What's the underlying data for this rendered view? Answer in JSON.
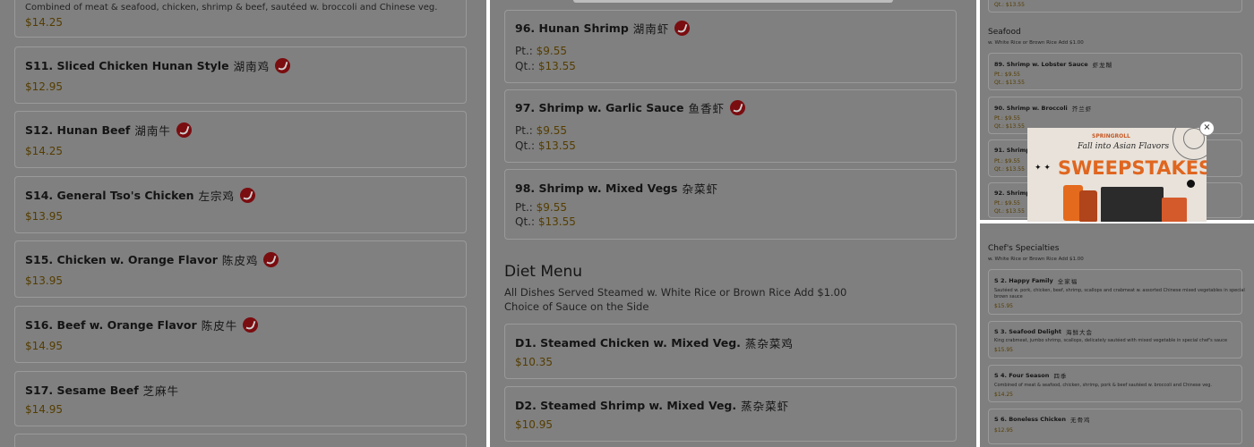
{
  "panel1": {
    "top_desc": "Combined of meat & seafood, chicken, shrimp & beef, sautéed w. broccoli and Chinese veg.",
    "top_price": "$14.25",
    "items": [
      {
        "name": "S11. Sliced Chicken Hunan Style",
        "cn": "湖南鸡",
        "price": "$12.95"
      },
      {
        "name": "S12. Hunan Beef",
        "cn": "湖南牛",
        "price": "$14.25"
      },
      {
        "name": "S14. General Tso's Chicken",
        "cn": "左宗鸡",
        "price": "$13.95"
      },
      {
        "name": "S15. Chicken w. Orange Flavor",
        "cn": "陈皮鸡",
        "price": "$13.95"
      },
      {
        "name": "S16. Beef w. Orange Flavor",
        "cn": "陈皮牛",
        "price": "$14.95"
      },
      {
        "name": "S17. Sesame Beef",
        "cn": "芝麻牛",
        "price": "$14.95"
      }
    ]
  },
  "panel2": {
    "items": [
      {
        "name": "96. Hunan Shrimp",
        "cn": "湖南虾",
        "pt_label": "Pt.:",
        "pt": "$9.55",
        "qt_label": "Qt.:",
        "qt": "$13.55"
      },
      {
        "name": "97. Shrimp w. Garlic Sauce",
        "cn": "鱼香虾",
        "pt_label": "Pt.:",
        "pt": "$9.55",
        "qt_label": "Qt.:",
        "qt": "$13.55"
      },
      {
        "name": "98. Shrimp w. Mixed Vegs",
        "cn": "杂菜虾",
        "pt_label": "Pt.:",
        "pt": "$9.55",
        "qt_label": "Qt.:",
        "qt": "$13.55"
      }
    ],
    "diet": {
      "title": "Diet Menu",
      "line1": "All Dishes Served Steamed w. White Rice or Brown Rice Add $1.00",
      "line2": "Choice of Sauce on the Side",
      "items": [
        {
          "name": "D1. Steamed Chicken w. Mixed Veg.",
          "cn": "蒸杂菜鸡",
          "price": "$10.35"
        },
        {
          "name": "D2. Steamed Shrimp w. Mixed Veg.",
          "cn": "蒸杂菜虾",
          "price": "$10.95"
        }
      ]
    }
  },
  "panel3": {
    "top_qt": "Qt.: $13.55",
    "seafood": {
      "title": "Seafood",
      "sub": "w. White Rice or Brown Rice Add $1.00",
      "items": [
        {
          "name": "89. Shrimp w. Lobster Sauce",
          "cn": "虾龙糊",
          "pt": "Pt.: $9.55",
          "qt": "Qt.: $13.55"
        },
        {
          "name": "90. Shrimp w. Broccoli",
          "cn": "芥兰虾",
          "pt": "Pt.: $9.55",
          "qt": "Qt.: $13.55"
        },
        {
          "name": "91. Shrimp",
          "cn": "",
          "pt": "Pt.: $9.55",
          "qt": "Qt.: $13.55"
        },
        {
          "name": "92. Shrimp",
          "cn": "",
          "pt": "Pt.: $9.55",
          "qt": "Qt.: $13.55"
        }
      ]
    },
    "chef": {
      "title": "Chef's Specialties",
      "sub": "w. White Rice or Brown Rice Add $1.00",
      "items": [
        {
          "name": "S 2. Happy Family",
          "cn": "全家福",
          "desc": "Sautéed w. pork, chicken, beef, shrimp, scallops and crabmeat w. assorted Chinese mixed vegetables in special",
          "desc2": "brown sauce",
          "price": "$15.95"
        },
        {
          "name": "S 3. Seafood Delight",
          "cn": "海鲜大会",
          "desc": "King crabmeat, jumbo shrimp, scallops, delicately sautéed with mixed vegetable in special chef's sauce",
          "desc2": "",
          "price": "$15.95"
        },
        {
          "name": "S 4. Four Season",
          "cn": "四季",
          "desc": "Combined of meat & seafood, chicken, shrimp, pork & beef sautéed w. broccoli and Chinese veg.",
          "desc2": "",
          "price": "$14.25"
        },
        {
          "name": "S 6. Boneless Chicken",
          "cn": "无骨鸡",
          "desc": "",
          "desc2": "",
          "price": "$12.95"
        }
      ]
    }
  },
  "popup": {
    "brand": "SPRINGROLL",
    "tagline": "Fall into Asian Flavors",
    "headline": "SWEEPSTAKES",
    "close": "×"
  },
  "colors": {
    "overlay": "#7f7f7f",
    "price": "#553d00",
    "hot_icon": "#7a0d10",
    "sweepstakes": "#e0661f"
  }
}
